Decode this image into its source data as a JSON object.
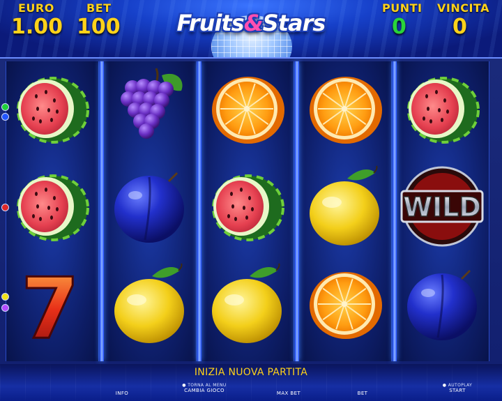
{
  "header": {
    "euro_label": "EURO",
    "euro_value": "1.00",
    "bet_label": "BET",
    "bet_value": "100",
    "punti_label": "PUNTI",
    "punti_value": "0",
    "vincita_label": "VINCITA",
    "vincita_value": "0",
    "logo_left": "Fruits",
    "logo_amp": "&",
    "logo_right": "Stars"
  },
  "reels": [
    [
      "watermelon",
      "watermelon",
      "seven"
    ],
    [
      "grapes",
      "plum",
      "lemon"
    ],
    [
      "orange",
      "watermelon",
      "lemon"
    ],
    [
      "orange",
      "lemon",
      "orange"
    ],
    [
      "watermelon",
      "wild",
      "plum"
    ]
  ],
  "wild_label": "WILD",
  "seven_label": "7",
  "message": "INIZIA NUOVA PARTITA",
  "buttons": {
    "info": "INFO",
    "torna_menu": "TORNA AL MENU",
    "cambia_gioco": "CAMBIA GIOCO",
    "max_bet": "MAX BET",
    "bet": "BET",
    "autoplay": "AUTOPLAY",
    "start": "START"
  },
  "colors": {
    "label_yellow": "#ffd21a",
    "value_green": "#29d43a",
    "reel_divider": "#8fb4ff"
  }
}
